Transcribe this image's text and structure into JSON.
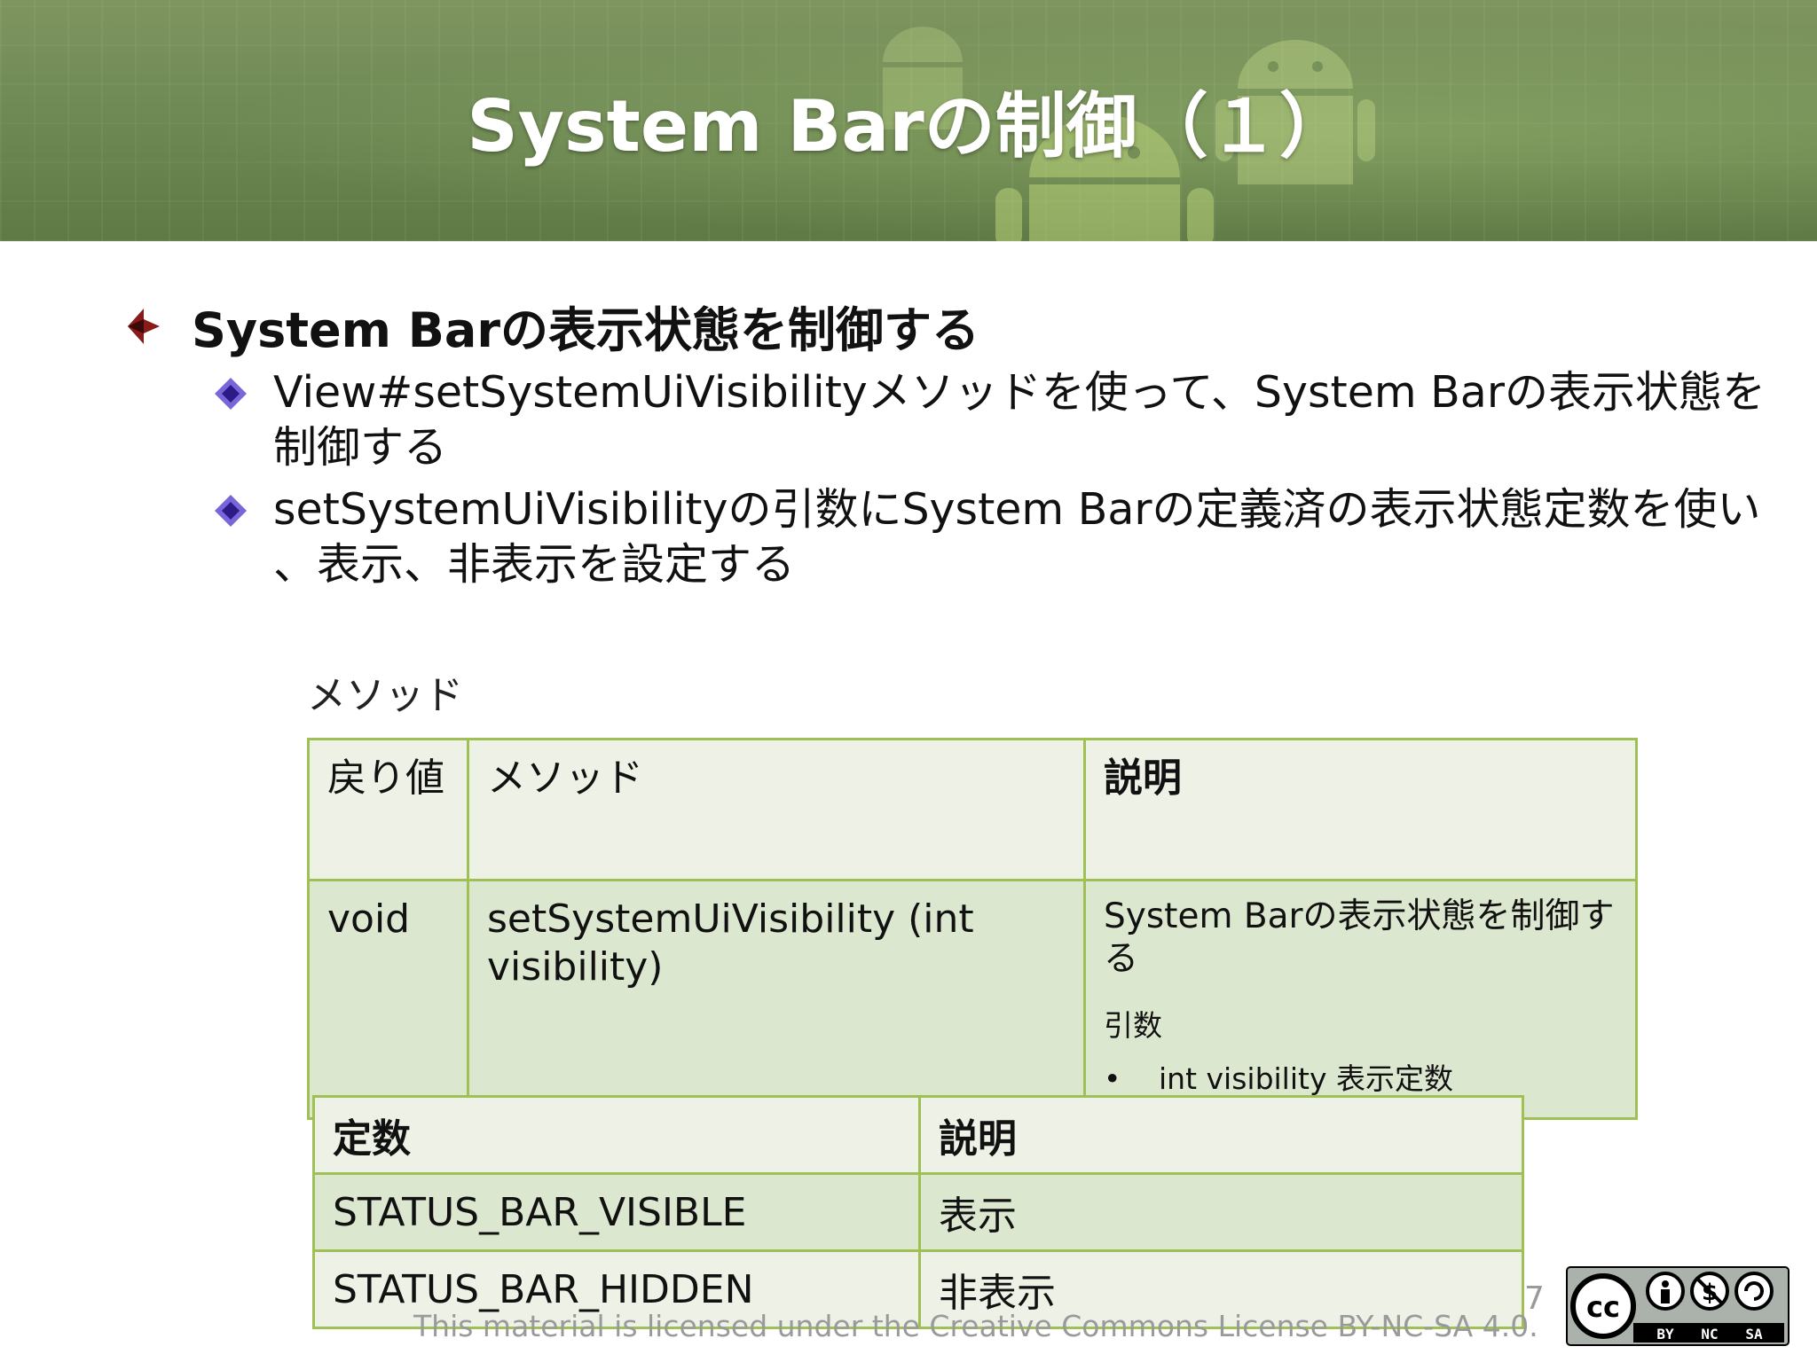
{
  "header": {
    "title": "System Barの制御（１）"
  },
  "bullets": {
    "main": "System Barの表示状態を制御する",
    "sub1_line1": "View#setSystemUiVisibilityメソッドを使って、System Barの表示状態を",
    "sub1_line2": "制御する",
    "sub2_line1": "setSystemUiVisibilityの引数にSystem Barの定義済の表示状態定数を使い",
    "sub2_line2": "、表示、非表示を設定する"
  },
  "caption": "メソッド",
  "methods_table": {
    "headers": [
      "戻り値",
      "メソッド",
      "説明"
    ],
    "row": {
      "return": "void",
      "method": "setSystemUiVisibility (int visibility)",
      "description": "System Barの表示状態を制御する",
      "arg_label": "引数",
      "arg_bullet": "•",
      "arg_item": "int visibility 表示定数"
    }
  },
  "constants_table": {
    "headers": [
      "定数",
      "説明"
    ],
    "rows": [
      [
        "STATUS_BAR_VISIBLE",
        "表示"
      ],
      [
        "STATUS_BAR_HIDDEN",
        "非表示"
      ]
    ]
  },
  "footer": {
    "page_number": "7",
    "license": "This material is licensed under the Creative Commons License BY-NC-SA 4.0.",
    "cc_labels": [
      "cc",
      "BY",
      "NC",
      "SA"
    ]
  },
  "colors": {
    "header_green": "#6f8a55",
    "table_border": "#9fc054",
    "table_header_bg": "#edf1e6",
    "table_body_bg": "#dce7cf",
    "bullet_main": "#8b1a1a",
    "bullet_sub": "#5a3fc0"
  }
}
